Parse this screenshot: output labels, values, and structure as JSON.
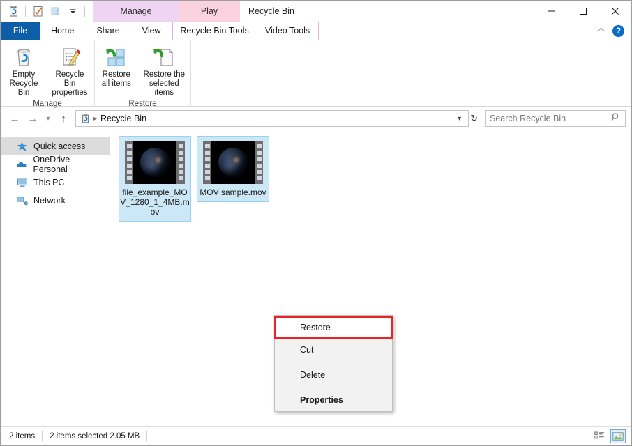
{
  "window": {
    "title": "Recycle Bin",
    "minimize_label": "Minimize",
    "maximize_label": "Maximize",
    "close_label": "Close"
  },
  "quick_access_toolbar": {
    "items": [
      {
        "name": "recycle-bin-icon",
        "label": "Recycle Bin"
      },
      {
        "name": "properties-icon",
        "label": "Properties"
      },
      {
        "name": "new-folder-icon",
        "label": "New folder"
      },
      {
        "name": "customize-dropdown",
        "label": "Customize Quick Access Toolbar"
      }
    ]
  },
  "contextual_tab_headers": [
    {
      "label": "Manage",
      "color": "#efd5f3"
    },
    {
      "label": "Play",
      "color": "#fbd2e0"
    }
  ],
  "ribbon_tabs": [
    {
      "label": "File",
      "active": false
    },
    {
      "label": "Home",
      "active": false
    },
    {
      "label": "Share",
      "active": false
    },
    {
      "label": "View",
      "active": false
    },
    {
      "label": "Recycle Bin Tools",
      "active": true
    },
    {
      "label": "Video Tools",
      "active": false
    }
  ],
  "ribbon_tabs_right": {
    "collapse_label": "Minimize the Ribbon",
    "help_label": "?"
  },
  "ribbon_groups": [
    {
      "label": "Manage",
      "buttons": [
        {
          "name": "empty-recycle-bin-button",
          "label": "Empty\nRecycle Bin",
          "icon": "recycle-bin-icon"
        },
        {
          "name": "recycle-bin-properties-button",
          "label": "Recycle Bin\nproperties",
          "icon": "properties-pencil-icon"
        }
      ]
    },
    {
      "label": "Restore",
      "buttons": [
        {
          "name": "restore-all-items-button",
          "label": "Restore\nall items",
          "icon": "restore-all-icon"
        },
        {
          "name": "restore-selected-items-button",
          "label": "Restore the\nselected items",
          "icon": "restore-selected-icon"
        }
      ]
    }
  ],
  "address_bar": {
    "back_label": "Back",
    "forward_label": "Forward",
    "recent_label": "Recent locations",
    "up_label": "Up",
    "breadcrumb_icon": "recycle-bin-icon",
    "breadcrumb": "Recycle Bin",
    "dropdown_label": "Previous locations",
    "refresh_label": "Refresh",
    "search_placeholder": "Search Recycle Bin",
    "search_value": ""
  },
  "sidebar": {
    "items": [
      {
        "label": "Quick access",
        "icon": "star-pin-icon",
        "selected": true
      },
      {
        "label": "OneDrive - Personal",
        "icon": "cloud-icon",
        "selected": false
      },
      {
        "label": "This PC",
        "icon": "monitor-icon",
        "selected": false
      },
      {
        "label": "Network",
        "icon": "network-icon",
        "selected": false
      }
    ]
  },
  "files": [
    {
      "name": "file_example_MOV_1280_1_4MB.mov",
      "selected": true,
      "thumbnail": "video-earth-thumbnail"
    },
    {
      "name": "MOV sample.mov",
      "selected": true,
      "thumbnail": "video-earth-thumbnail"
    }
  ],
  "context_menu": {
    "items": [
      {
        "label": "Restore",
        "highlighted": true,
        "bold": false,
        "separator_after": false
      },
      {
        "label": "Cut",
        "highlighted": false,
        "bold": false,
        "separator_after": true
      },
      {
        "label": "Delete",
        "highlighted": false,
        "bold": false,
        "separator_after": true
      },
      {
        "label": "Properties",
        "highlighted": false,
        "bold": true,
        "separator_after": false
      }
    ],
    "highlight_color": "#ee2222"
  },
  "status_bar": {
    "item_count": "2 items",
    "selection_info": "2 items selected  2.05 MB",
    "views": [
      {
        "name": "details-view-button",
        "label": "Details view",
        "active": false
      },
      {
        "name": "large-icons-view-button",
        "label": "Large icons view",
        "active": true
      }
    ]
  },
  "colors": {
    "accent_blue": "#0d5ea6",
    "selection_blue": "#cce8f7",
    "manage_tab": "#efd5f3",
    "play_tab": "#fbd2e0",
    "highlight_red": "#ee2222"
  }
}
